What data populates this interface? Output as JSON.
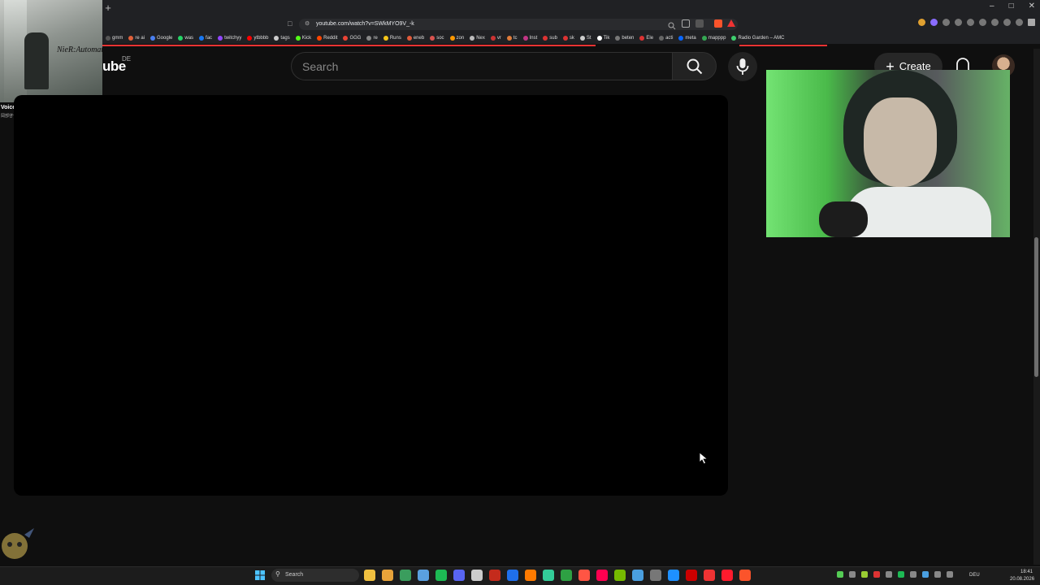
{
  "browser": {
    "new_tab": "+",
    "url": "youtube.com/watch?v=SWkMYO9V_-k",
    "bookmarks": [
      {
        "label": "gmm",
        "color": "#555555"
      },
      {
        "label": "re ai",
        "color": "#e0603a"
      },
      {
        "label": "Google",
        "color": "#4a7ff0"
      },
      {
        "label": "was",
        "color": "#25d366"
      },
      {
        "label": "fac",
        "color": "#1877f2"
      },
      {
        "label": "twitchyy",
        "color": "#9146ff"
      },
      {
        "label": "ytbbbb",
        "color": "#ff0000"
      },
      {
        "label": "tags",
        "color": "#cccccc"
      },
      {
        "label": "Kick",
        "color": "#53fc18"
      },
      {
        "label": "Reddit",
        "color": "#ff4500"
      },
      {
        "label": "GGG",
        "color": "#ea4335"
      },
      {
        "label": "re",
        "color": "#888888"
      },
      {
        "label": "Runs",
        "color": "#f5c518"
      },
      {
        "label": "eneb",
        "color": "#e05a3a"
      },
      {
        "label": "soc",
        "color": "#d9534f"
      },
      {
        "label": "zon",
        "color": "#ff9900"
      },
      {
        "label": "Nex",
        "color": "#bbbbbb"
      },
      {
        "label": "vr",
        "color": "#cc3333"
      },
      {
        "label": "tc",
        "color": "#e07b39"
      },
      {
        "label": "Inst",
        "color": "#c13584"
      },
      {
        "label": "sub",
        "color": "#d33"
      },
      {
        "label": "sk",
        "color": "#d33"
      },
      {
        "label": "St",
        "color": "#ccc"
      },
      {
        "label": "Tik",
        "color": "#ffffff"
      },
      {
        "label": "beten",
        "color": "#777"
      },
      {
        "label": "Ele",
        "color": "#d33"
      },
      {
        "label": "acti",
        "color": "#666"
      },
      {
        "label": "meta",
        "color": "#0866ff"
      },
      {
        "label": "mapppp",
        "color": "#34a853"
      },
      {
        "label": "Radio Garden – AMC",
        "color": "#3ecf6e"
      }
    ]
  },
  "now_playing": {
    "album_logo": "NieR:Automata",
    "title": "Voice of no Return - Guitar",
    "artist": "岡部啓一"
  },
  "youtube": {
    "logo": "ube",
    "region": "DE",
    "search_placeholder": "Search",
    "create_label": "Create"
  },
  "taskbar": {
    "search_label": "Search",
    "apps": [
      "#f0c040",
      "#e8a33a",
      "#3a9d5d",
      "#5aa0e0",
      "#1db954",
      "#5865f2",
      "#cccccc",
      "#c42b1c",
      "#1f6feb",
      "#ff7a00",
      "#3c9",
      "#2ea043",
      "#f54",
      "#ff0050",
      "#76b900",
      "#4a9fe0",
      "#777777",
      "#1e90ff",
      "#c00",
      "#e33",
      "#ff1b2d",
      "#fb542b"
    ],
    "language": "DEU",
    "time": "18:41",
    "date": "20.08.2026"
  },
  "colors": {
    "accent_red": "#ff0000",
    "background": "#0f0f0f"
  }
}
